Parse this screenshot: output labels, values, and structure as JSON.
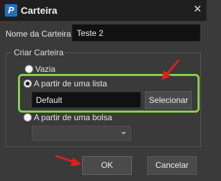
{
  "window": {
    "title": "Carteira",
    "icon": "app-logo-icon",
    "close_glyph": "✕"
  },
  "name_field": {
    "label": "Nome da Carteira:",
    "value": "Teste 2"
  },
  "group": {
    "title": "Criar Carteira",
    "options": [
      {
        "label": "Vazia",
        "checked": false
      },
      {
        "label": "A partir de uma lista",
        "checked": true
      },
      {
        "label": "A partir de uma bolsa",
        "checked": false
      }
    ],
    "list_value": "Default",
    "select_button": "Selecionar",
    "exchange_value": ""
  },
  "buttons": {
    "ok": "OK",
    "cancel": "Cancelar"
  },
  "colors": {
    "highlight": "#88d04a",
    "arrow": "#e02020",
    "icon": "#2a6db5"
  }
}
